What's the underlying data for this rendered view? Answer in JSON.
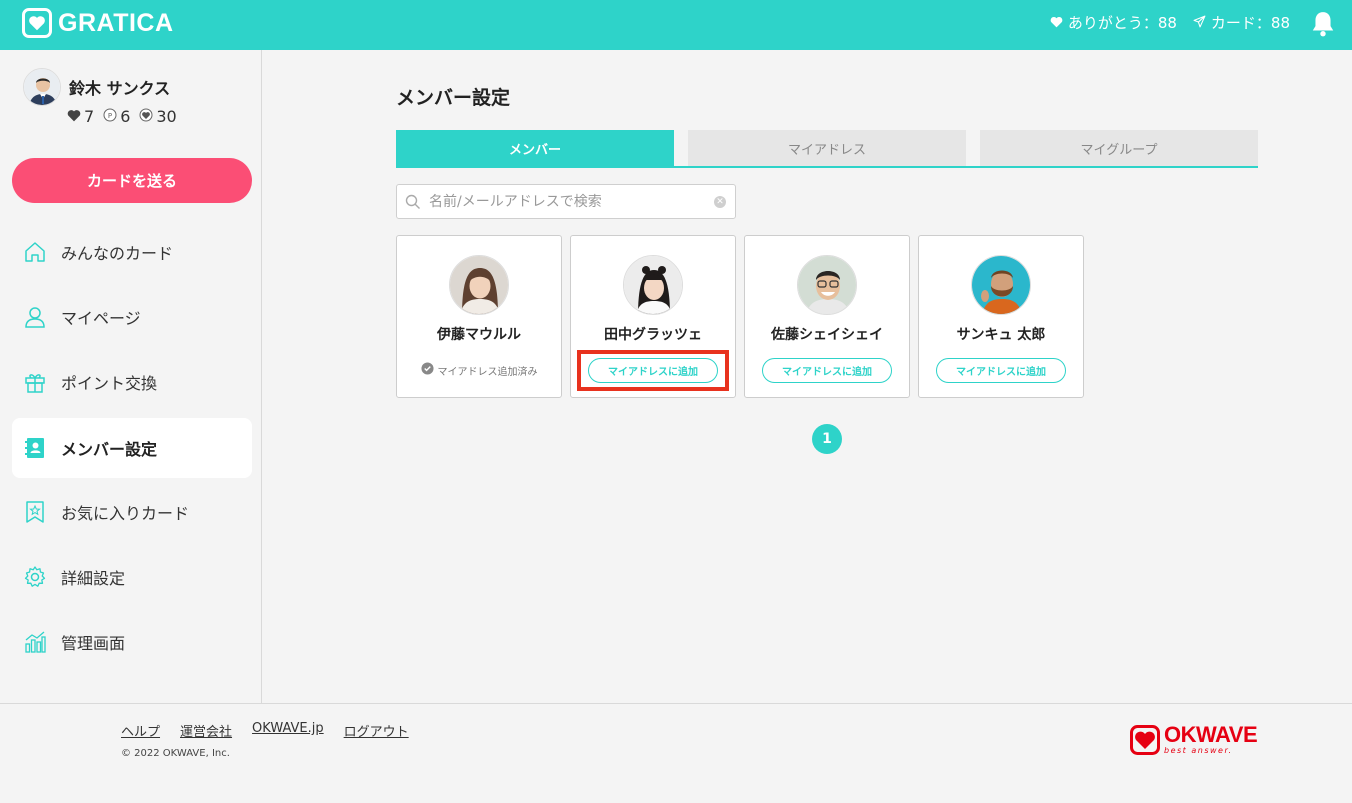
{
  "header": {
    "brand": "GRATICA",
    "thanks_label": "ありがとう：88",
    "cards_label": "カード：88"
  },
  "user": {
    "name": "鈴木 サンクス",
    "hearts": "7",
    "points": "6",
    "badges": "30"
  },
  "sidebar": {
    "send_button": "カードを送る",
    "items": [
      {
        "label": "みんなのカード",
        "icon": "home-icon"
      },
      {
        "label": "マイページ",
        "icon": "person-icon"
      },
      {
        "label": "ポイント交換",
        "icon": "gift-icon"
      },
      {
        "label": "メンバー設定",
        "icon": "contacts-icon",
        "active": true
      },
      {
        "label": "お気に入りカード",
        "icon": "bookmark-star-icon"
      },
      {
        "label": "詳細設定",
        "icon": "gear-icon"
      },
      {
        "label": "管理画面",
        "icon": "chart-icon"
      }
    ]
  },
  "main": {
    "title": "メンバー設定",
    "tabs": [
      {
        "label": "メンバー",
        "active": true
      },
      {
        "label": "マイアドレス"
      },
      {
        "label": "マイグループ"
      }
    ],
    "search": {
      "placeholder": "名前/メールアドレスで検索",
      "value": ""
    },
    "members": [
      {
        "name": "伊藤マウルル",
        "status": "マイアドレス追加済み",
        "added": true
      },
      {
        "name": "田中グラッツェ",
        "button": "マイアドレスに追加",
        "added": false
      },
      {
        "name": "佐藤シェイシェイ",
        "button": "マイアドレスに追加",
        "added": false
      },
      {
        "name": "サンキュ 太郎",
        "button": "マイアドレスに追加",
        "added": false
      }
    ],
    "pagination": {
      "current": "1"
    }
  },
  "footer": {
    "links": [
      "ヘルプ",
      "運営会社",
      "OKWAVE.jp",
      "ログアウト"
    ],
    "copyright": "© 2022 OKWAVE, Inc.",
    "partner": {
      "name": "OKWAVE",
      "tagline": "best answer."
    }
  },
  "colors": {
    "accent": "#2ed3c9",
    "send_button": "#fb4e75",
    "highlight": "#e8321e",
    "partner_red": "#e60012"
  }
}
